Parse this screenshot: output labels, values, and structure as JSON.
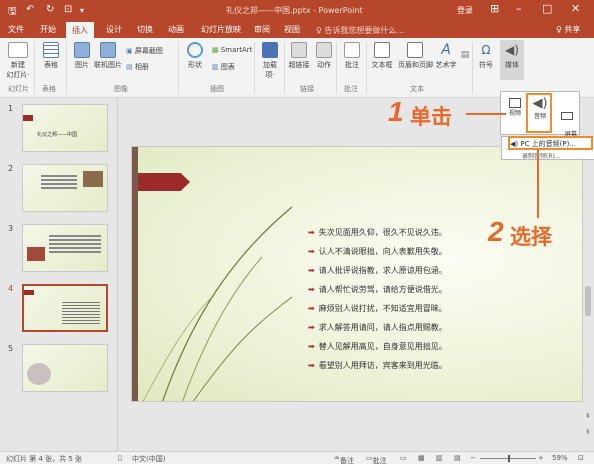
{
  "titlebar": {
    "doc_title": "礼仪之邦——中国.pptx - PowerPoint",
    "sign_in": "登录"
  },
  "tabs": [
    {
      "label": "文件"
    },
    {
      "label": "开始"
    },
    {
      "label": "插入"
    },
    {
      "label": "设计"
    },
    {
      "label": "切换"
    },
    {
      "label": "动画"
    },
    {
      "label": "幻灯片放映"
    },
    {
      "label": "审阅"
    },
    {
      "label": "视图"
    }
  ],
  "tell_me": "♀ 告诉我您想要做什么...",
  "share": "♀ 共享",
  "ribbon": {
    "buttons": [
      {
        "label": "新建\n幻灯片·"
      },
      {
        "label": "表格"
      },
      {
        "label": "图片"
      },
      {
        "label": "联机图片"
      },
      {
        "label": "屏幕截图"
      },
      {
        "label": "相册"
      },
      {
        "label": "形状"
      },
      {
        "label": "SmartArt"
      },
      {
        "label": "图表"
      },
      {
        "label": "加载\n项·"
      },
      {
        "label": "超链接"
      },
      {
        "label": "动作"
      },
      {
        "label": "批注"
      },
      {
        "label": "文本框"
      },
      {
        "label": "页眉和页脚"
      },
      {
        "label": "艺术字"
      },
      {
        "label": "符号"
      },
      {
        "label": "媒体"
      }
    ],
    "groups": [
      {
        "label": "幻灯片"
      },
      {
        "label": "表格"
      },
      {
        "label": "图像"
      },
      {
        "label": "插图"
      },
      {
        "label": "链接"
      },
      {
        "label": "批注"
      },
      {
        "label": "文本"
      }
    ]
  },
  "media_dropdown": {
    "video": "视频",
    "audio": "音频",
    "screen_record": "屏幕\n录制"
  },
  "audio_menu": {
    "pc_audio": "PC 上的音频(P)...",
    "record_audio": "录制音频(R)..."
  },
  "callouts": {
    "step1_num": "1",
    "step1_text": "单击",
    "step2_num": "2",
    "step2_text": "选择"
  },
  "thumbnails": [
    {
      "num": "1",
      "text": "礼仪之邦——中国"
    },
    {
      "num": "2",
      "text": ""
    },
    {
      "num": "3",
      "text": ""
    },
    {
      "num": "4",
      "text": ""
    },
    {
      "num": "5",
      "text": ""
    }
  ],
  "slide_lines": [
    "失次见面用久仰，很久不见说久违。",
    "认人不清说眼拙，向人表歉用失敬。",
    "请人批评说指教，求人原谅用包涵。",
    "请人帮忙说劳驾，请给方便说借光。",
    "麻烦别人说打扰，不知适宜用冒昧。",
    "求人解答用请问，请人指点用赐教。",
    "替人见解用高见，自身意见用拙见。",
    "看望别人用拜访，宾客来到用光临。"
  ],
  "statusbar": {
    "slide_info": "幻灯片 第 4 张，共 5 张",
    "language": "中文(中国)",
    "notes": "备注",
    "comments": "批注",
    "zoom": "59%"
  },
  "colors": {
    "accent": "#b7472a",
    "callout": "#e8692a"
  }
}
